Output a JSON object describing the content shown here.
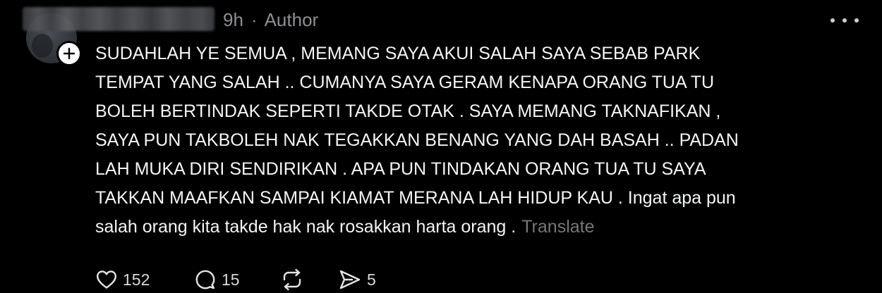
{
  "post": {
    "time": "9h",
    "separator": "·",
    "role_label": "Author",
    "body_lines": [
      "SUDAHLAH YE SEMUA , MEMANG SAYA AKUI SALAH SAYA SEBAB PARK",
      "TEMPAT YANG SALAH .. CUMANYA SAYA GERAM KENAPA ORANG TUA TU",
      "BOLEH BERTINDAK SEPERTI TAKDE OTAK . SAYA MEMANG TAKNAFIKAN ,",
      "SAYA PUN TAKBOLEH NAK TEGAKKAN BENANG YANG DAH BASAH .. PADAN",
      "LAH MUKA DIRI SENDIRIKAN . APA PUN TINDAKAN ORANG TUA TU SAYA",
      "TAKKAN MAAFKAN SAMPAI KIAMAT MERANA LAH HIDUP KAU . Ingat apa pun",
      "salah orang kita takde hak nak rosakkan harta orang ."
    ],
    "translate_label": "Translate"
  },
  "actions": {
    "like_count": "152",
    "reply_count": "15",
    "share_count": "5"
  },
  "icons": {
    "follow": "plus-icon",
    "more": "more-dots-icon",
    "like": "heart-icon",
    "reply": "comment-bubble-icon",
    "repost": "repost-icon",
    "share": "send-icon"
  },
  "colors": {
    "background": "#000000",
    "text": "#f3f5f7",
    "muted": "#8e8e93",
    "translate": "#77777b"
  }
}
